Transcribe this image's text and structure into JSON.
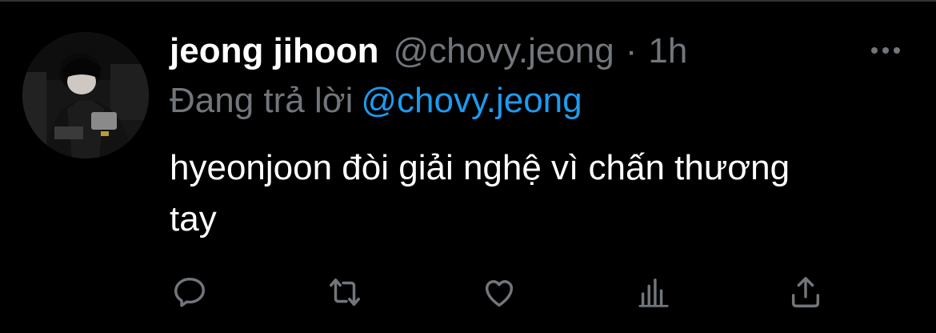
{
  "tweet": {
    "author": {
      "display_name": "jeong jihoon",
      "handle": "@chovy.jeong"
    },
    "separator": "·",
    "time": "1h",
    "reply_context": {
      "prefix": "Đang trả lời",
      "mention": "@chovy.jeong"
    },
    "text": "hyeonjoon đòi giải nghệ vì chấn thương tay"
  },
  "actions": [
    {
      "icon": "reply-icon"
    },
    {
      "icon": "retweet-icon"
    },
    {
      "icon": "like-icon"
    },
    {
      "icon": "analytics-icon"
    },
    {
      "icon": "share-icon"
    }
  ],
  "colors": {
    "background": "#000000",
    "primary_text": "#ffffff",
    "secondary_text": "#71767b",
    "accent": "#1d9bf0",
    "divider": "#2f3336"
  }
}
